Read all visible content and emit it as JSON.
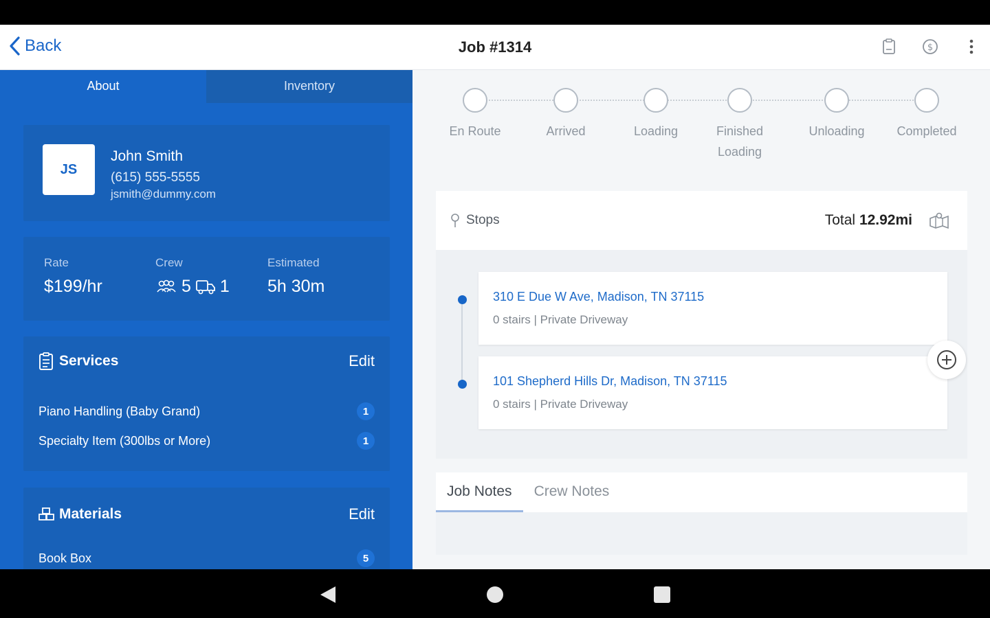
{
  "app_bar": {
    "back_label": "Back",
    "title": "Job #1314",
    "actions": [
      "clipboard-icon",
      "dollar-icon",
      "more-vertical-icon"
    ]
  },
  "left_tabs": [
    {
      "label": "About",
      "active": true
    },
    {
      "label": "Inventory",
      "active": false
    }
  ],
  "customer": {
    "initials": "JS",
    "name": "John Smith",
    "phone": "(615) 555-5555",
    "email": "jsmith@dummy.com"
  },
  "rates": {
    "rate_label": "Rate",
    "rate_value": "$199/hr",
    "crew_label": "Crew",
    "crew_people": "5",
    "crew_trucks": "1",
    "estimated_label": "Estimated",
    "estimated_value": "5h 30m"
  },
  "services": {
    "title": "Services",
    "edit_label": "Edit",
    "items": [
      {
        "name": "Piano Handling (Baby Grand)",
        "qty": "1"
      },
      {
        "name": "Specialty Item (300lbs or More)",
        "qty": "1"
      }
    ]
  },
  "materials": {
    "title": "Materials",
    "edit_label": "Edit",
    "items": [
      {
        "name": "Book Box",
        "qty": "5"
      }
    ]
  },
  "steps": [
    {
      "label": "En Route"
    },
    {
      "label": "Arrived"
    },
    {
      "label": "Loading"
    },
    {
      "label": "Finished Loading"
    },
    {
      "label": "Unloading"
    },
    {
      "label": "Completed"
    }
  ],
  "stops": {
    "title": "Stops",
    "total_label": "Total",
    "total_value": "12.92mi",
    "items": [
      {
        "address": "310 E Due W Ave, Madison, TN 37115",
        "detail": "0 stairs | Private Driveway"
      },
      {
        "address": "101 Shepherd Hills Dr, Madison, TN 37115",
        "detail": "0 stairs | Private Driveway"
      }
    ]
  },
  "notes_tabs": [
    {
      "label": "Job Notes",
      "active": true
    },
    {
      "label": "Crew Notes",
      "active": false
    }
  ],
  "colors": {
    "primary": "#1766c8",
    "panel": "#1861b8",
    "link": "#1e6bc9"
  }
}
